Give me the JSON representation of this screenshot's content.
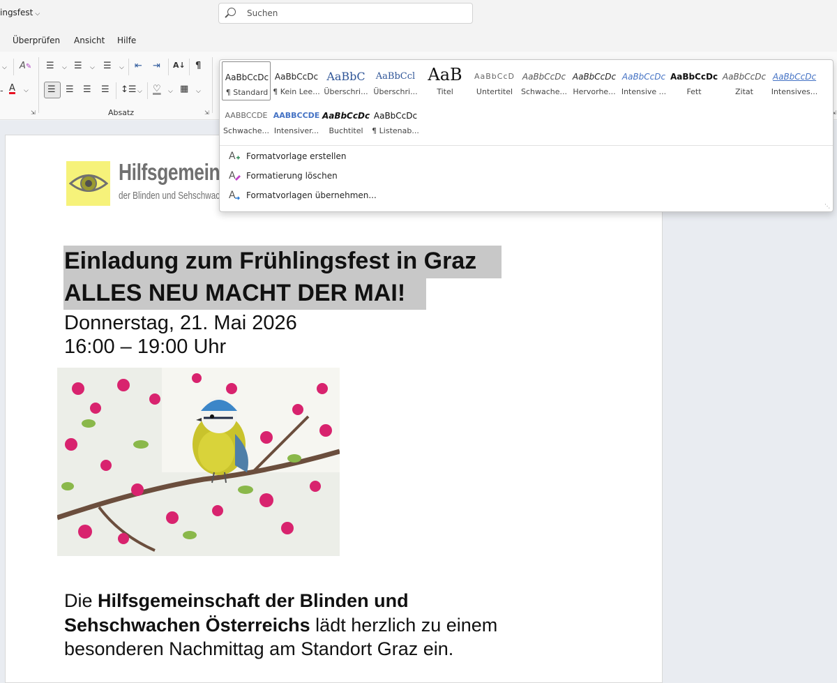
{
  "window": {
    "doc_title": "ingsfest",
    "search_placeholder": "Suchen"
  },
  "menu": {
    "tabs": [
      "Überprüfen",
      "Ansicht",
      "Hilfe"
    ]
  },
  "ribbon": {
    "absatz_label": "Absatz"
  },
  "styles_gallery": {
    "tiles_row1": [
      {
        "preview": "AaBbCcDc",
        "label": "¶ Standard"
      },
      {
        "preview": "AaBbCcDc",
        "label": "¶ Kein Lee..."
      },
      {
        "preview": "AaBbC",
        "label": "Überschri..."
      },
      {
        "preview": "AaBbCcl",
        "label": "Überschri..."
      },
      {
        "preview": "AaB",
        "label": "Titel"
      },
      {
        "preview": "AaBbCcD",
        "label": "Untertitel"
      },
      {
        "preview": "AaBbCcDc",
        "label": "Schwache..."
      },
      {
        "preview": "AaBbCcDc",
        "label": "Hervorhe..."
      },
      {
        "preview": "AaBbCcDc",
        "label": "Intensive ..."
      },
      {
        "preview": "AaBbCcDc",
        "label": "Fett"
      },
      {
        "preview": "AaBbCcDc",
        "label": "Zitat"
      },
      {
        "preview": "AaBbCcDc",
        "label": "Intensives..."
      }
    ],
    "tiles_row2": [
      {
        "preview": "AABBCCDE",
        "label": "Schwache..."
      },
      {
        "preview": "AABBCCDE",
        "label": "Intensiver..."
      },
      {
        "preview": "AaBbCcDc",
        "label": "Buchtitel"
      },
      {
        "preview": "AaBbCcDc",
        "label": "¶ Listenab..."
      }
    ],
    "menu_items": [
      "Formatvorlage erstellen",
      "Formatierung löschen",
      "Formatvorlagen übernehmen..."
    ]
  },
  "document": {
    "logo_line1": "Hilfsgemein",
    "logo_line2": "der Blinden und Sehschwac",
    "heading1": "Einladung zum Frühlingsfest in Graz",
    "heading2": "ALLES NEU MACHT DER MAI!",
    "date": "Donnerstag, 21. Mai 2026",
    "time": "16:00 – 19:00 Uhr",
    "para_line1_pre": "Die ",
    "para_line1_bold": "Hilfsgemeinschaft der Blinden und",
    "para_line2_bold": "Sehschwachen Österreichs",
    "para_line2_post": " lädt herzlich zu einem",
    "para_line3": "besonderen Nachmittag am Standort Graz ein."
  },
  "colors": {
    "accent": "#2b579a",
    "highlight": "#c8c8c8",
    "logo_yellow": "#f6f27a",
    "font_color_red": "#e81123"
  }
}
